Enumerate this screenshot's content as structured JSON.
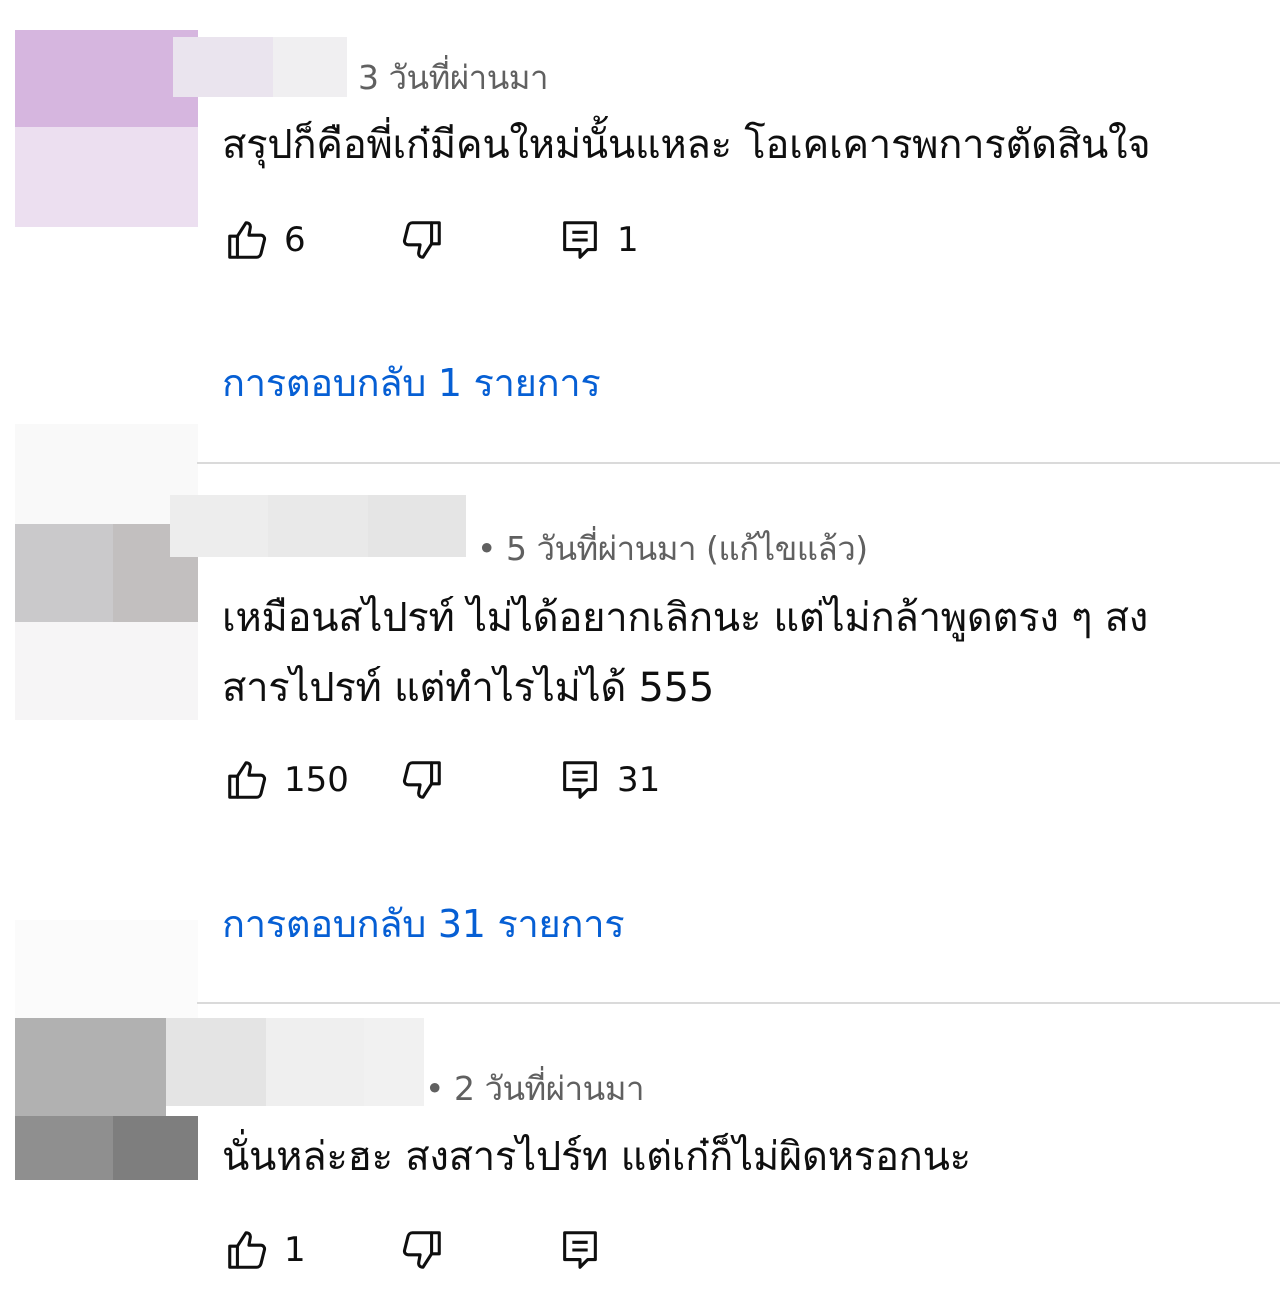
{
  "comments": [
    {
      "meta": "3 วันที่ผ่านมา",
      "lines": [
        "สรุปก็คือพี่เก๋มีคนใหม่นั้นแหละ โอเคเคารพการตัดสินใจ"
      ],
      "likes": "6",
      "replies_count": "1",
      "replies_label": "การตอบกลับ 1 รายการ"
    },
    {
      "meta": "• 5 วันที่ผ่านมา (แก้ไขแล้ว)",
      "lines": [
        "เหมือนสไปรท์ ไม่ได้อยากเลิกนะ แต่ไม่กล้าพูดตรง ๆ สง",
        "สารไปรท์ แต่ทำไรไม่ได้  555"
      ],
      "likes": "150",
      "replies_count": "31",
      "replies_label": "การตอบกลับ 31 รายการ"
    },
    {
      "meta": "• 2 วันที่ผ่านมา",
      "lines": [
        "นั่นหล่ะฮะ สงสารไปร์ท แต่เก๋ก็ไม่ผิดหรอกนะ"
      ],
      "likes": "1",
      "replies_count": "",
      "replies_label": ""
    }
  ],
  "icons": {
    "like": "thumbs-up-icon",
    "dislike": "thumbs-down-icon",
    "reply": "comment-icon"
  },
  "colors": {
    "link": "#065fd4",
    "meta": "#606060",
    "divider": "#dadada"
  }
}
